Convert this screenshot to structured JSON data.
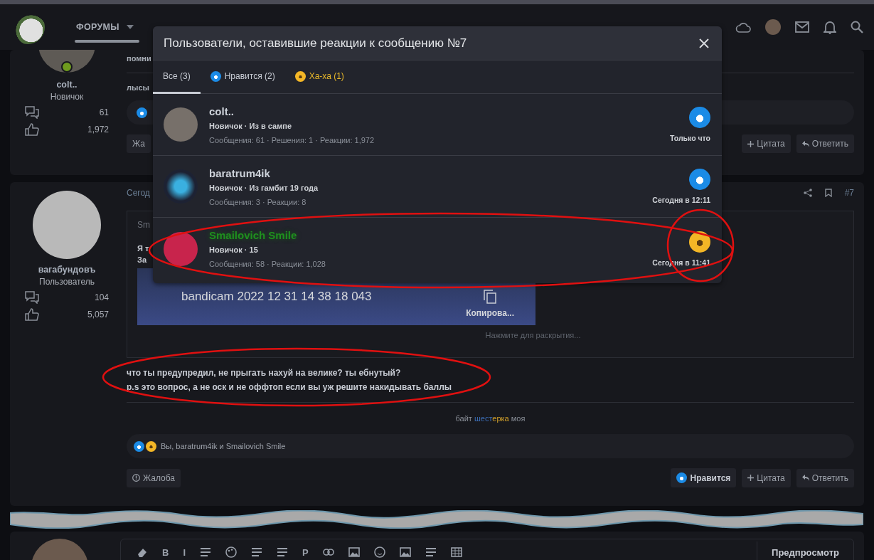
{
  "header": {
    "nav": [
      {
        "label": "ФОРУМЫ",
        "selected": true,
        "dropdown": true
      }
    ]
  },
  "posts": [
    {
      "author": "colt..",
      "role": "Новичок",
      "online": true,
      "messages": "61",
      "reactions": "1,972",
      "lines": [
        "помни",
        "лысы"
      ],
      "report": "Жа",
      "quote": "Цитата",
      "reply": "Ответить"
    },
    {
      "author": "вагабундовъ",
      "role": "Пользователь",
      "online": false,
      "messages": "104",
      "reactions": "5,057",
      "date": "Сегод",
      "number": "#7",
      "quote_author": "Sm",
      "quote_lines": [
        "Я т",
        "За"
      ],
      "attachment": {
        "title": "bandicam 2022 12 31 14 38 18 043",
        "copy": "Копирова..."
      },
      "expand": "Нажмите для раскрытия...",
      "body": [
        "что ты предупредил, не прыгать нахуй на велике? ты ебнутый?",
        "p.s это вопрос, а не оск и не оффтоп если вы уж решите накидывать баллы"
      ],
      "signature": [
        {
          "text": "байт ",
          "color": "#8a8f98"
        },
        {
          "text": "шест",
          "color": "#3d6fb8"
        },
        {
          "text": "ерка",
          "color": "#d4a22a"
        },
        {
          "text": " моя",
          "color": "#8a8f98"
        }
      ],
      "reacted": "Вы, baratrum4ik и Smailovich Smile",
      "report": "Жалоба",
      "like": "Нравится",
      "quote": "Цитата",
      "reply": "Ответить"
    }
  ],
  "editor": {
    "tools": [
      {
        "kind": "eraser"
      },
      {
        "kind": "text",
        "label": "B"
      },
      {
        "kind": "text",
        "label": "I"
      },
      {
        "kind": "lines"
      },
      {
        "kind": "palette"
      },
      {
        "kind": "lines"
      },
      {
        "kind": "lines"
      },
      {
        "kind": "text",
        "label": "P"
      },
      {
        "kind": "link"
      },
      {
        "kind": "image"
      },
      {
        "kind": "smile"
      },
      {
        "kind": "image"
      },
      {
        "kind": "lines"
      },
      {
        "kind": "table"
      }
    ],
    "preview": "Предпросмотр"
  },
  "modal": {
    "title": "Пользователи, оставившие реакции к сообщению №7",
    "tabs": [
      {
        "label": "Все (3)",
        "kind": "all",
        "selected": true
      },
      {
        "label": "Нравится (2)",
        "kind": "like",
        "selected": false
      },
      {
        "label": "Ха-ха (1)",
        "kind": "haha",
        "selected": false
      }
    ],
    "users": [
      {
        "name": "colt..",
        "kind": "like",
        "highlight": false,
        "title": "Новичок · Из в сампе",
        "stats": "Сообщения: 61 · Решения: 1 · Реакции: 1,972",
        "time": "Только что"
      },
      {
        "name": "baratrum4ik",
        "kind": "like",
        "highlight": false,
        "title": "Новичок · Из гамбит 19 года",
        "stats": "Сообщения: 3 · Реакции: 8",
        "time": "Сегодня в 12:11"
      },
      {
        "name": "Smailovich Smile",
        "kind": "haha",
        "highlight": true,
        "title": "Новичок · 15",
        "stats": "Сообщения: 58 · Реакции: 1,028",
        "time": "Сегодня в 11:41"
      }
    ]
  }
}
